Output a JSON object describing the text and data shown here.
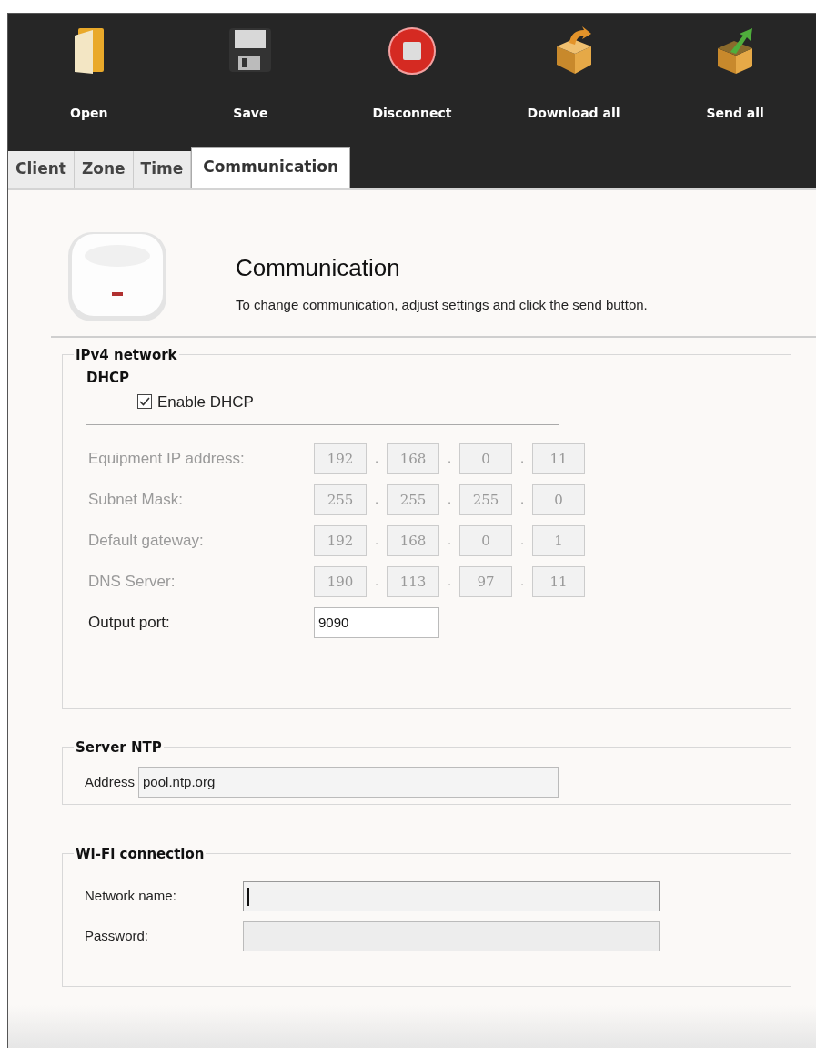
{
  "toolbar": [
    {
      "kind": "folder",
      "label": "Open"
    },
    {
      "kind": "floppy",
      "label": "Save"
    },
    {
      "kind": "stop",
      "label": "Disconnect"
    },
    {
      "kind": "box-down",
      "label": "Download all"
    },
    {
      "kind": "box-up",
      "label": "Send all"
    }
  ],
  "tabs": [
    {
      "label": "Client",
      "selected": false
    },
    {
      "label": "Zone",
      "selected": false
    },
    {
      "label": "Time",
      "selected": false
    },
    {
      "label": "Communication",
      "selected": true
    }
  ],
  "header": {
    "title": "Communication",
    "description": "To change communication, adjust settings and click the send button."
  },
  "ipv4": {
    "legend": "IPv4 network",
    "dhcp_heading": "DHCP",
    "dhcp_checkbox": {
      "label": "Enable DHCP",
      "checked": true
    },
    "separator": ".",
    "addresses": [
      {
        "label": "Equipment IP address:",
        "octets": [
          "192",
          "168",
          "0",
          "11"
        ]
      },
      {
        "label": "Subnet Mask:",
        "octets": [
          "255",
          "255",
          "255",
          "0"
        ]
      },
      {
        "label": "Default gateway:",
        "octets": [
          "192",
          "168",
          "0",
          "1"
        ]
      },
      {
        "label": "DNS Server:",
        "octets": [
          "190",
          "113",
          "97",
          "11"
        ]
      }
    ],
    "output_port": {
      "label": "Output port:",
      "value": "9090"
    }
  },
  "ntp": {
    "legend": "Server NTP",
    "label": "Address",
    "value": "pool.ntp.org"
  },
  "wifi": {
    "legend": "Wi-Fi connection",
    "fields": [
      {
        "label": "Network name:",
        "focused": true
      },
      {
        "label": "Password:",
        "focused": false
      }
    ]
  }
}
